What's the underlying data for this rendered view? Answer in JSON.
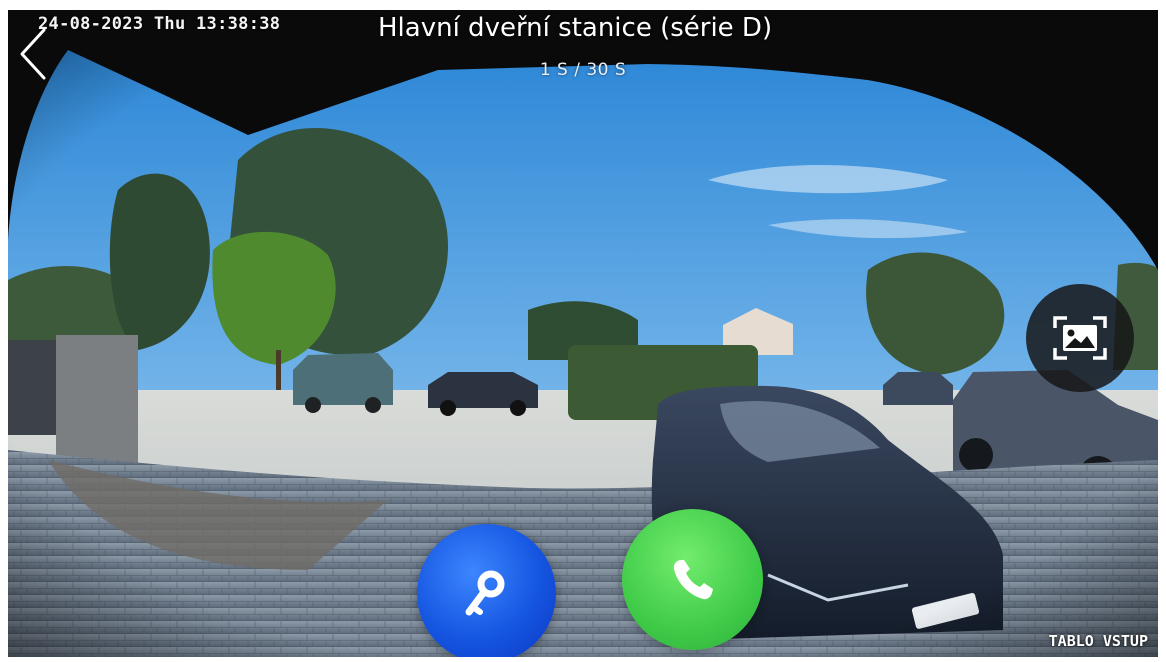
{
  "header": {
    "osd_datetime": "24-08-2023 Thu 13:38:38",
    "title": "Hlavní dveřní stanice (série D)",
    "timer": "1 S / 30 S"
  },
  "controls": {
    "back_icon": "chevron-left-icon",
    "snapshot_icon": "image-capture-icon",
    "unlock_icon": "key-icon",
    "call_icon": "phone-icon"
  },
  "overlay": {
    "station_label": "TABLO VSTUP"
  },
  "colors": {
    "unlock_button": "#1555e0",
    "call_button": "#3fcb48",
    "snapshot_button": "#161618"
  }
}
